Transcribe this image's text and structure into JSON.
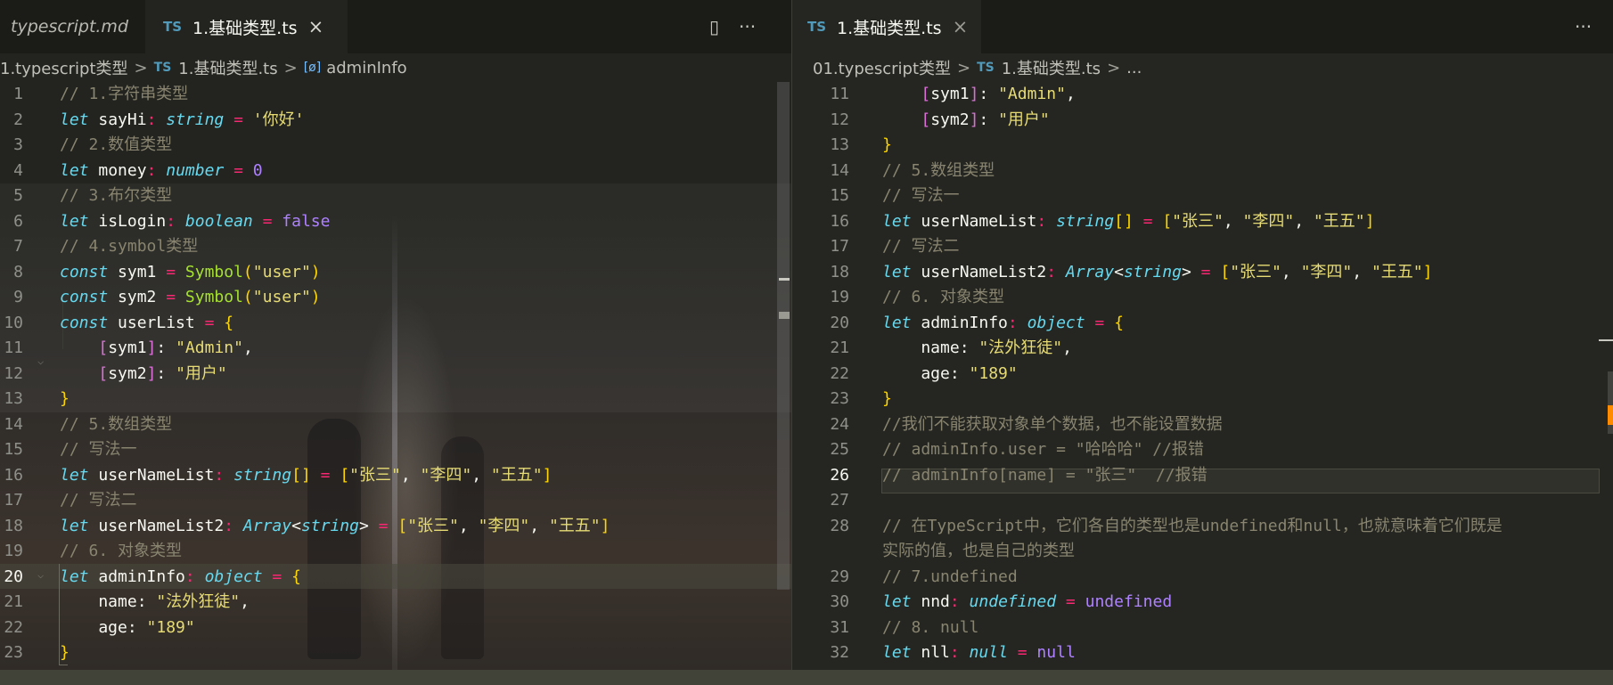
{
  "left": {
    "tabs": [
      {
        "label": "typescript.md",
        "active": false
      },
      {
        "label": "1.基础类型.ts",
        "active": true,
        "lang": "TS",
        "close": "×"
      }
    ],
    "actions": {
      "split": "▯",
      "more": "···"
    },
    "breadcrumb": [
      "1.typescript类型",
      "1.基础类型.ts",
      "adminInfo"
    ],
    "breadcrumb_lang": "TS",
    "breadcrumb_symbol": "[ø]",
    "lines": [
      {
        "no": "1",
        "tokens": [
          [
            "c",
            "// 1.字符串类型"
          ]
        ]
      },
      {
        "no": "2",
        "tokens": [
          [
            "k",
            "let"
          ],
          [
            "v",
            " sayHi"
          ],
          [
            "o",
            ":"
          ],
          [
            "t",
            " string"
          ],
          [
            "o",
            " ="
          ],
          [
            "s",
            " '你好'"
          ]
        ]
      },
      {
        "no": "3",
        "tokens": [
          [
            "c",
            "// 2.数值类型"
          ]
        ]
      },
      {
        "no": "4",
        "tokens": [
          [
            "k",
            "let"
          ],
          [
            "v",
            " money"
          ],
          [
            "o",
            ":"
          ],
          [
            "t",
            " number"
          ],
          [
            "o",
            " ="
          ],
          [
            "n",
            " 0"
          ]
        ]
      },
      {
        "no": "5",
        "tokens": [
          [
            "c",
            "// 3.布尔类型"
          ]
        ]
      },
      {
        "no": "6",
        "tokens": [
          [
            "k",
            "let"
          ],
          [
            "v",
            " isLogin"
          ],
          [
            "o",
            ":"
          ],
          [
            "t",
            " boolean"
          ],
          [
            "o",
            " ="
          ],
          [
            "n",
            " false"
          ]
        ]
      },
      {
        "no": "7",
        "tokens": [
          [
            "c",
            "// 4.symbol类型"
          ]
        ]
      },
      {
        "no": "8",
        "tokens": [
          [
            "k",
            "const"
          ],
          [
            "v",
            " sym1 "
          ],
          [
            "o",
            "="
          ],
          [
            "f",
            " Symbol"
          ],
          [
            "b",
            "("
          ],
          [
            "s",
            "\"user\""
          ],
          [
            "b",
            ")"
          ]
        ]
      },
      {
        "no": "9",
        "tokens": [
          [
            "k",
            "const"
          ],
          [
            "v",
            " sym2 "
          ],
          [
            "o",
            "="
          ],
          [
            "f",
            " Symbol"
          ],
          [
            "b",
            "("
          ],
          [
            "s",
            "\"user\""
          ],
          [
            "b",
            ")"
          ]
        ]
      },
      {
        "no": "10",
        "tokens": [
          [
            "k",
            "const"
          ],
          [
            "v",
            " userList "
          ],
          [
            "o",
            "="
          ],
          [
            "b",
            " {"
          ]
        ]
      },
      {
        "no": "11",
        "tokens": [
          [
            "v",
            "    "
          ],
          [
            "bp",
            "["
          ],
          [
            "v",
            "sym1"
          ],
          [
            "bp",
            "]"
          ],
          [
            "v",
            ": "
          ],
          [
            "s",
            "\"Admin\""
          ],
          [
            "v",
            ","
          ]
        ]
      },
      {
        "no": "12",
        "tokens": [
          [
            "v",
            "    "
          ],
          [
            "bp",
            "["
          ],
          [
            "v",
            "sym2"
          ],
          [
            "bp",
            "]"
          ],
          [
            "v",
            ": "
          ],
          [
            "s",
            "\"用户\""
          ]
        ]
      },
      {
        "no": "13",
        "tokens": [
          [
            "b",
            "}"
          ]
        ]
      },
      {
        "no": "14",
        "tokens": [
          [
            "c",
            "// 5.数组类型"
          ]
        ]
      },
      {
        "no": "15",
        "tokens": [
          [
            "c",
            "// 写法一"
          ]
        ]
      },
      {
        "no": "16",
        "tokens": [
          [
            "k",
            "let"
          ],
          [
            "v",
            " userNameList"
          ],
          [
            "o",
            ":"
          ],
          [
            "t",
            " string"
          ],
          [
            "b",
            "[]"
          ],
          [
            "o",
            " ="
          ],
          [
            "b",
            " ["
          ],
          [
            "s",
            "\"张三\""
          ],
          [
            "v",
            ", "
          ],
          [
            "s",
            "\"李四\""
          ],
          [
            "v",
            ", "
          ],
          [
            "s",
            "\"王五\""
          ],
          [
            "b",
            "]"
          ]
        ]
      },
      {
        "no": "17",
        "tokens": [
          [
            "c",
            "// 写法二"
          ]
        ]
      },
      {
        "no": "18",
        "tokens": [
          [
            "k",
            "let"
          ],
          [
            "v",
            " userNameList2"
          ],
          [
            "o",
            ":"
          ],
          [
            "t",
            " Array"
          ],
          [
            "v",
            "<"
          ],
          [
            "t",
            "string"
          ],
          [
            "v",
            "> "
          ],
          [
            "o",
            "="
          ],
          [
            "b",
            " ["
          ],
          [
            "s",
            "\"张三\""
          ],
          [
            "v",
            ", "
          ],
          [
            "s",
            "\"李四\""
          ],
          [
            "v",
            ", "
          ],
          [
            "s",
            "\"王五\""
          ],
          [
            "b",
            "]"
          ]
        ]
      },
      {
        "no": "19",
        "tokens": [
          [
            "c",
            "// 6. 对象类型"
          ]
        ]
      },
      {
        "no": "20",
        "tokens": [
          [
            "k",
            "let"
          ],
          [
            "v",
            " adminInfo"
          ],
          [
            "o",
            ":"
          ],
          [
            "t",
            " object"
          ],
          [
            "o",
            " ="
          ],
          [
            "b",
            " {"
          ]
        ]
      },
      {
        "no": "21",
        "tokens": [
          [
            "v",
            "    name: "
          ],
          [
            "s",
            "\"法外狂徒\""
          ],
          [
            "v",
            ","
          ]
        ]
      },
      {
        "no": "22",
        "tokens": [
          [
            "v",
            "    age: "
          ],
          [
            "s",
            "\"189\""
          ]
        ]
      },
      {
        "no": "23",
        "tokens": [
          [
            "b",
            "}"
          ]
        ]
      }
    ]
  },
  "right": {
    "tabs": [
      {
        "label": "1.基础类型.ts",
        "active": true,
        "lang": "TS",
        "close": "×"
      }
    ],
    "actions": {
      "more": "···"
    },
    "breadcrumb": [
      "01.typescript类型",
      "1.基础类型.ts",
      "..."
    ],
    "breadcrumb_lang": "TS",
    "lines": [
      {
        "no": "11",
        "tokens": [
          [
            "v",
            "    "
          ],
          [
            "bp",
            "["
          ],
          [
            "v",
            "sym1"
          ],
          [
            "bp",
            "]"
          ],
          [
            "v",
            ": "
          ],
          [
            "s",
            "\"Admin\""
          ],
          [
            "v",
            ","
          ]
        ]
      },
      {
        "no": "12",
        "tokens": [
          [
            "v",
            "    "
          ],
          [
            "bp",
            "["
          ],
          [
            "v",
            "sym2"
          ],
          [
            "bp",
            "]"
          ],
          [
            "v",
            ": "
          ],
          [
            "s",
            "\"用户\""
          ]
        ]
      },
      {
        "no": "13",
        "tokens": [
          [
            "b",
            "}"
          ]
        ]
      },
      {
        "no": "14",
        "tokens": [
          [
            "c",
            "// 5.数组类型"
          ]
        ]
      },
      {
        "no": "15",
        "tokens": [
          [
            "c",
            "// 写法一"
          ]
        ]
      },
      {
        "no": "16",
        "tokens": [
          [
            "k",
            "let"
          ],
          [
            "v",
            " userNameList"
          ],
          [
            "o",
            ":"
          ],
          [
            "t",
            " string"
          ],
          [
            "b",
            "[]"
          ],
          [
            "o",
            " ="
          ],
          [
            "b",
            " ["
          ],
          [
            "s",
            "\"张三\""
          ],
          [
            "v",
            ", "
          ],
          [
            "s",
            "\"李四\""
          ],
          [
            "v",
            ", "
          ],
          [
            "s",
            "\"王五\""
          ],
          [
            "b",
            "]"
          ]
        ]
      },
      {
        "no": "17",
        "tokens": [
          [
            "c",
            "// 写法二"
          ]
        ]
      },
      {
        "no": "18",
        "tokens": [
          [
            "k",
            "let"
          ],
          [
            "v",
            " userNameList2"
          ],
          [
            "o",
            ":"
          ],
          [
            "t",
            " Array"
          ],
          [
            "v",
            "<"
          ],
          [
            "t",
            "string"
          ],
          [
            "v",
            "> "
          ],
          [
            "o",
            "="
          ],
          [
            "b",
            " ["
          ],
          [
            "s",
            "\"张三\""
          ],
          [
            "v",
            ", "
          ],
          [
            "s",
            "\"李四\""
          ],
          [
            "v",
            ", "
          ],
          [
            "s",
            "\"王五\""
          ],
          [
            "b",
            "]"
          ]
        ]
      },
      {
        "no": "19",
        "tokens": [
          [
            "c",
            "// 6. 对象类型"
          ]
        ]
      },
      {
        "no": "20",
        "tokens": [
          [
            "k",
            "let"
          ],
          [
            "v",
            " adminInfo"
          ],
          [
            "o",
            ":"
          ],
          [
            "t",
            " object"
          ],
          [
            "o",
            " ="
          ],
          [
            "b",
            " {"
          ]
        ]
      },
      {
        "no": "21",
        "tokens": [
          [
            "v",
            "    name: "
          ],
          [
            "s",
            "\"法外狂徒\""
          ],
          [
            "v",
            ","
          ]
        ]
      },
      {
        "no": "22",
        "tokens": [
          [
            "v",
            "    age: "
          ],
          [
            "s",
            "\"189\""
          ]
        ]
      },
      {
        "no": "23",
        "tokens": [
          [
            "b",
            "}"
          ]
        ]
      },
      {
        "no": "24",
        "tokens": [
          [
            "c",
            "//我们不能获取对象单个数据，也不能设置数据"
          ]
        ]
      },
      {
        "no": "25",
        "tokens": [
          [
            "c",
            "// adminInfo.user = \"哈哈哈\" //报错"
          ]
        ]
      },
      {
        "no": "26",
        "tokens": [
          [
            "c",
            "// adminInfo[name] = \"张三\"  //报错"
          ]
        ]
      },
      {
        "no": "27",
        "tokens": []
      },
      {
        "no": "28",
        "tokens": [
          [
            "c",
            "// 在TypeScript中，它们各自的类型也是undefined和null，也就意味着它们既是实际的值，也是自己的类型"
          ]
        ]
      },
      {
        "no": "29",
        "tokens": [
          [
            "c",
            "// 7.undefined"
          ]
        ]
      },
      {
        "no": "30",
        "tokens": [
          [
            "k",
            "let"
          ],
          [
            "v",
            " nnd"
          ],
          [
            "o",
            ":"
          ],
          [
            "t",
            " undefined"
          ],
          [
            "o",
            " ="
          ],
          [
            "n",
            " undefined"
          ]
        ]
      },
      {
        "no": "31",
        "tokens": [
          [
            "c",
            "// 8. null"
          ]
        ]
      },
      {
        "no": "32",
        "tokens": [
          [
            "k",
            "let"
          ],
          [
            "v",
            " nll"
          ],
          [
            "o",
            ":"
          ],
          [
            "t",
            " null"
          ],
          [
            "o",
            " ="
          ],
          [
            "n",
            " null"
          ]
        ]
      }
    ]
  }
}
